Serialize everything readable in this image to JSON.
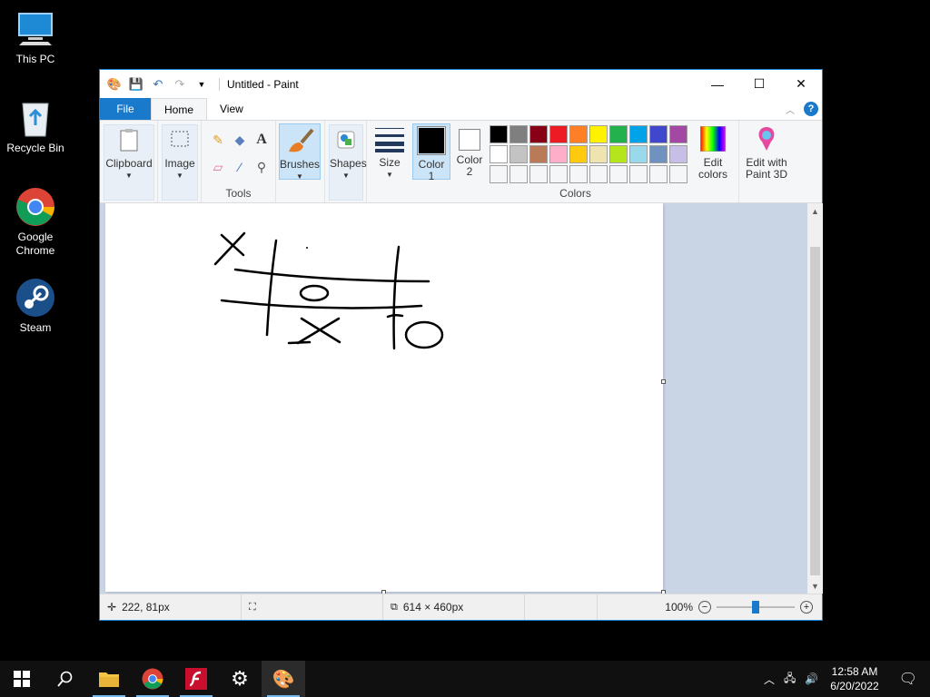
{
  "desktop": {
    "icons": [
      {
        "label": "This PC"
      },
      {
        "label": "Recycle Bin"
      },
      {
        "label": "Google Chrome"
      },
      {
        "label": "Steam"
      }
    ]
  },
  "window": {
    "title": "Untitled - Paint",
    "tabs": [
      "File",
      "Home",
      "View"
    ]
  },
  "ribbon": {
    "clipboard_label": "Clipboard",
    "image_label": "Image",
    "tools_label": "Tools",
    "brushes_label": "Brushes",
    "shapes_label": "Shapes",
    "size_label": "Size",
    "color1_label": "Color 1",
    "color2_label": "Color 2",
    "colors_label": "Colors",
    "edit_colors_label": "Edit colors",
    "paint3d_label": "Edit with Paint 3D",
    "palette_row1": [
      "#000000",
      "#7f7f7f",
      "#880015",
      "#ed1c24",
      "#ff7f27",
      "#fff200",
      "#22b14c",
      "#00a2e8",
      "#3f48cc",
      "#a349a4"
    ],
    "palette_row2": [
      "#ffffff",
      "#c3c3c3",
      "#b97a57",
      "#ffaec9",
      "#ffc90e",
      "#efe4b0",
      "#b5e61d",
      "#99d9ea",
      "#7092be",
      "#c8bfe7"
    ],
    "palette_row3": [
      "#f5f6f7",
      "#f5f6f7",
      "#f5f6f7",
      "#f5f6f7",
      "#f5f6f7",
      "#f5f6f7",
      "#f5f6f7",
      "#f5f6f7",
      "#f5f6f7",
      "#f5f6f7"
    ],
    "color1": "#000000",
    "color2": "#ffffff"
  },
  "status": {
    "cursor_pos": "222, 81px",
    "canvas_size": "614 × 460px",
    "zoom": "100%",
    "zoom_level": 0.5
  },
  "taskbar": {
    "time": "12:58 AM",
    "date": "6/20/2022"
  },
  "colors": {
    "accent": "#1979ca",
    "canvas_bg": "#c9d4e5"
  }
}
